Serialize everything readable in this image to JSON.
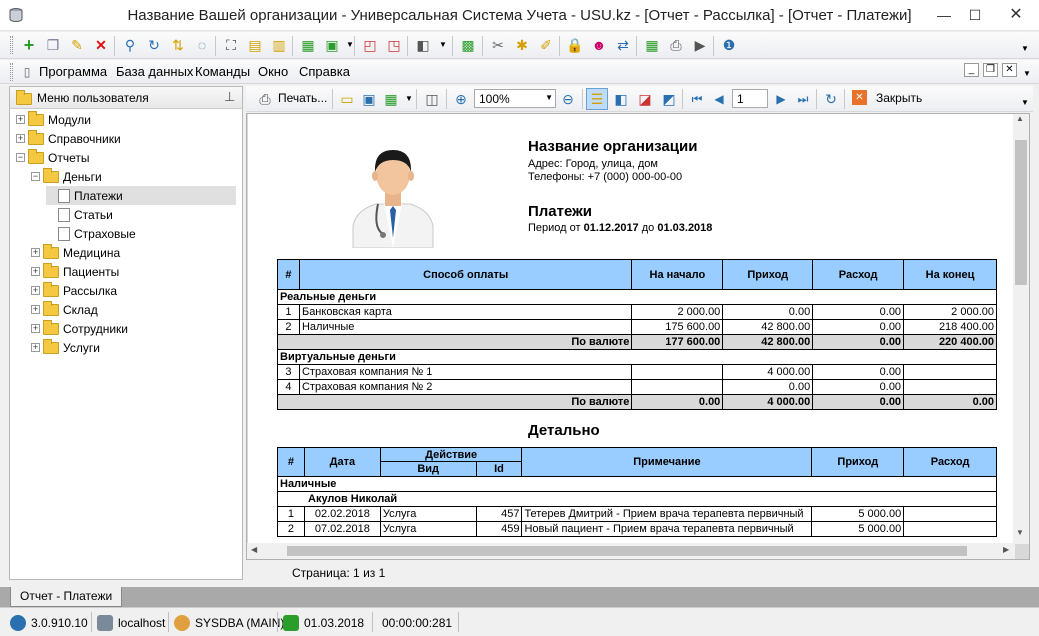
{
  "window": {
    "title": "Название Вашей организации - Универсальная Система Учета - USU.kz - [Отчет - Рассылка] - [Отчет - Платежи]",
    "minimize": "—",
    "maximize": "☐",
    "close": "✕"
  },
  "menu": {
    "items": [
      "Программа",
      "База данных",
      "Команды",
      "Окно",
      "Справка"
    ]
  },
  "left_panel": {
    "title": "Меню пользователя",
    "tree": [
      {
        "label": "Модули",
        "level": 0,
        "expander": "+",
        "kind": "folder"
      },
      {
        "label": "Справочники",
        "level": 0,
        "expander": "+",
        "kind": "folder"
      },
      {
        "label": "Отчеты",
        "level": 0,
        "expander": "−",
        "kind": "folder"
      },
      {
        "label": "Деньги",
        "level": 1,
        "expander": "−",
        "kind": "folder"
      },
      {
        "label": "Платежи",
        "level": 2,
        "expander": "",
        "kind": "doc",
        "selected": true
      },
      {
        "label": "Статьи",
        "level": 2,
        "expander": "",
        "kind": "doc"
      },
      {
        "label": "Страховые",
        "level": 2,
        "expander": "",
        "kind": "doc"
      },
      {
        "label": "Медицина",
        "level": 1,
        "expander": "+",
        "kind": "folder"
      },
      {
        "label": "Пациенты",
        "level": 1,
        "expander": "+",
        "kind": "folder"
      },
      {
        "label": "Рассылка",
        "level": 1,
        "expander": "+",
        "kind": "folder"
      },
      {
        "label": "Склад",
        "level": 1,
        "expander": "+",
        "kind": "folder"
      },
      {
        "label": "Сотрудники",
        "level": 1,
        "expander": "+",
        "kind": "folder"
      },
      {
        "label": "Услуги",
        "level": 1,
        "expander": "+",
        "kind": "folder"
      }
    ]
  },
  "report_toolbar": {
    "print_label": "Печать...",
    "zoom_value": "100%",
    "page_number": "1",
    "close_label": "Закрыть"
  },
  "report": {
    "org_name": "Название организации",
    "address": "Адрес: Город, улица, дом",
    "phones": "Телефоны: +7 (000) 000-00-00",
    "heading": "Платежи",
    "period_prefix": "Период от",
    "period_from": "01.12.2017",
    "period_mid": "до",
    "period_to": "01.03.2018",
    "summary_headers": [
      "#",
      "Способ оплаты",
      "На начало",
      "Приход",
      "Расход",
      "На конец"
    ],
    "sections": [
      {
        "title": "Реальные деньги",
        "rows": [
          [
            "1",
            "Банковская карта",
            "2 000.00",
            "0.00",
            "0.00",
            "2 000.00"
          ],
          [
            "2",
            "Наличные",
            "175 600.00",
            "42 800.00",
            "0.00",
            "218 400.00"
          ]
        ],
        "total": [
          "По валюте",
          "177 600.00",
          "42 800.00",
          "0.00",
          "220 400.00"
        ]
      },
      {
        "title": "Виртуальные деньги",
        "rows": [
          [
            "3",
            "Страховая компания № 1",
            "",
            "4 000.00",
            "0.00",
            ""
          ],
          [
            "4",
            "Страховая компания № 2",
            "",
            "0.00",
            "0.00",
            ""
          ]
        ],
        "total": [
          "По валюте",
          "0.00",
          "4 000.00",
          "0.00",
          "0.00"
        ]
      }
    ],
    "detail_heading": "Детально",
    "detail_headers": {
      "num": "#",
      "date": "Дата",
      "action": "Действие",
      "kind": "Вид",
      "id": "Id",
      "note": "Примечание",
      "income": "Приход",
      "expense": "Расход"
    },
    "detail_section": "Наличные",
    "detail_person": "Акулов Николай",
    "detail_rows": [
      [
        "1",
        "02.02.2018",
        "Услуга",
        "457",
        "Тетерев Дмитрий - Прием врача терапевта первичный",
        "5 000.00",
        ""
      ],
      [
        "2",
        "07.02.2018",
        "Услуга",
        "459",
        "Новый пациент - Прием врача терапевта первичный",
        "5 000.00",
        ""
      ]
    ]
  },
  "report_status": "Страница: 1 из 1",
  "doc_tab": "Отчет - Платежи",
  "statusbar": {
    "version": "3.0.910.10",
    "server": "localhost",
    "user": "SYSDBA (MAIN)",
    "date": "01.03.2018",
    "timer": "00:00:00:281"
  },
  "colors": {
    "header_fill": "#99ccff",
    "total_fill": "#d9d9d9",
    "folder": "#f5c842"
  }
}
